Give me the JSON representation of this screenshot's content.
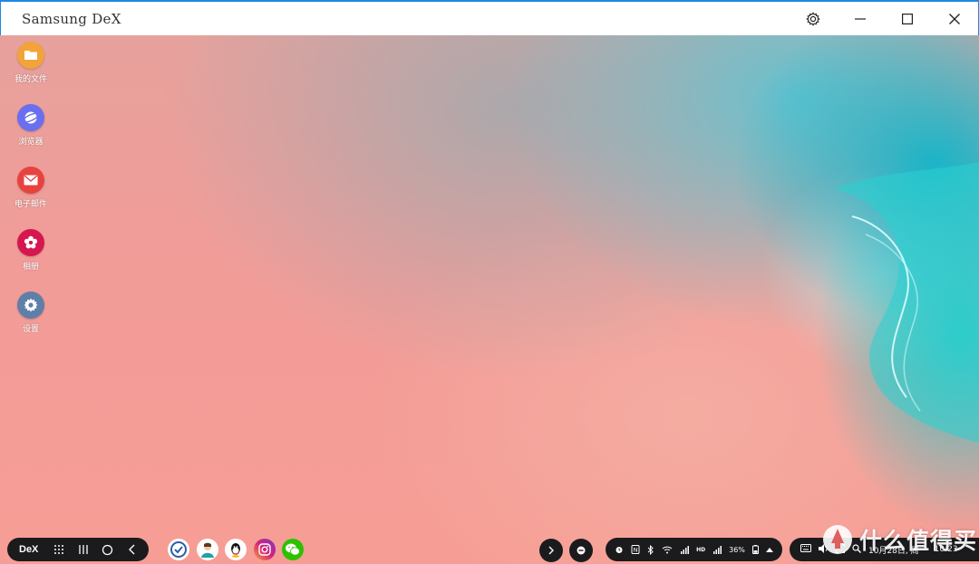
{
  "window": {
    "title": "Samsung DeX",
    "controls": {
      "settings": "gear-icon",
      "minimize": "minimize-icon",
      "maximize": "maximize-icon",
      "close": "close-icon"
    }
  },
  "desktop": {
    "icons": [
      {
        "label": "我的文件",
        "icon": "folder-icon",
        "color": "#f2a33a"
      },
      {
        "label": "浏览器",
        "icon": "browser-icon",
        "color": "#6a6ff0"
      },
      {
        "label": "电子邮件",
        "icon": "mail-icon",
        "color": "#e8423f"
      },
      {
        "label": "相册",
        "icon": "gallery-icon",
        "color": "#d6164f"
      },
      {
        "label": "设置",
        "icon": "settings-icon",
        "color": "#5f7fa8"
      }
    ]
  },
  "taskbar": {
    "dex_label": "DeX",
    "nav": [
      "apps-grid-icon",
      "recents-icon",
      "home-icon",
      "back-icon"
    ],
    "apps": [
      {
        "icon": "app-check-icon",
        "color": "#ffffff"
      },
      {
        "icon": "app-avatar-icon",
        "color": "#ffffff"
      },
      {
        "icon": "qq-icon",
        "color": "#ffffff"
      },
      {
        "icon": "instagram-icon",
        "color": "#c1358a"
      },
      {
        "icon": "wechat-icon",
        "color": "#2dc100"
      }
    ],
    "status": {
      "hd": "HD",
      "battery": "36%"
    },
    "clock": {
      "date": "10月28日, 周一",
      "time": "10:23"
    }
  },
  "watermark": {
    "text": "什么值得买"
  }
}
